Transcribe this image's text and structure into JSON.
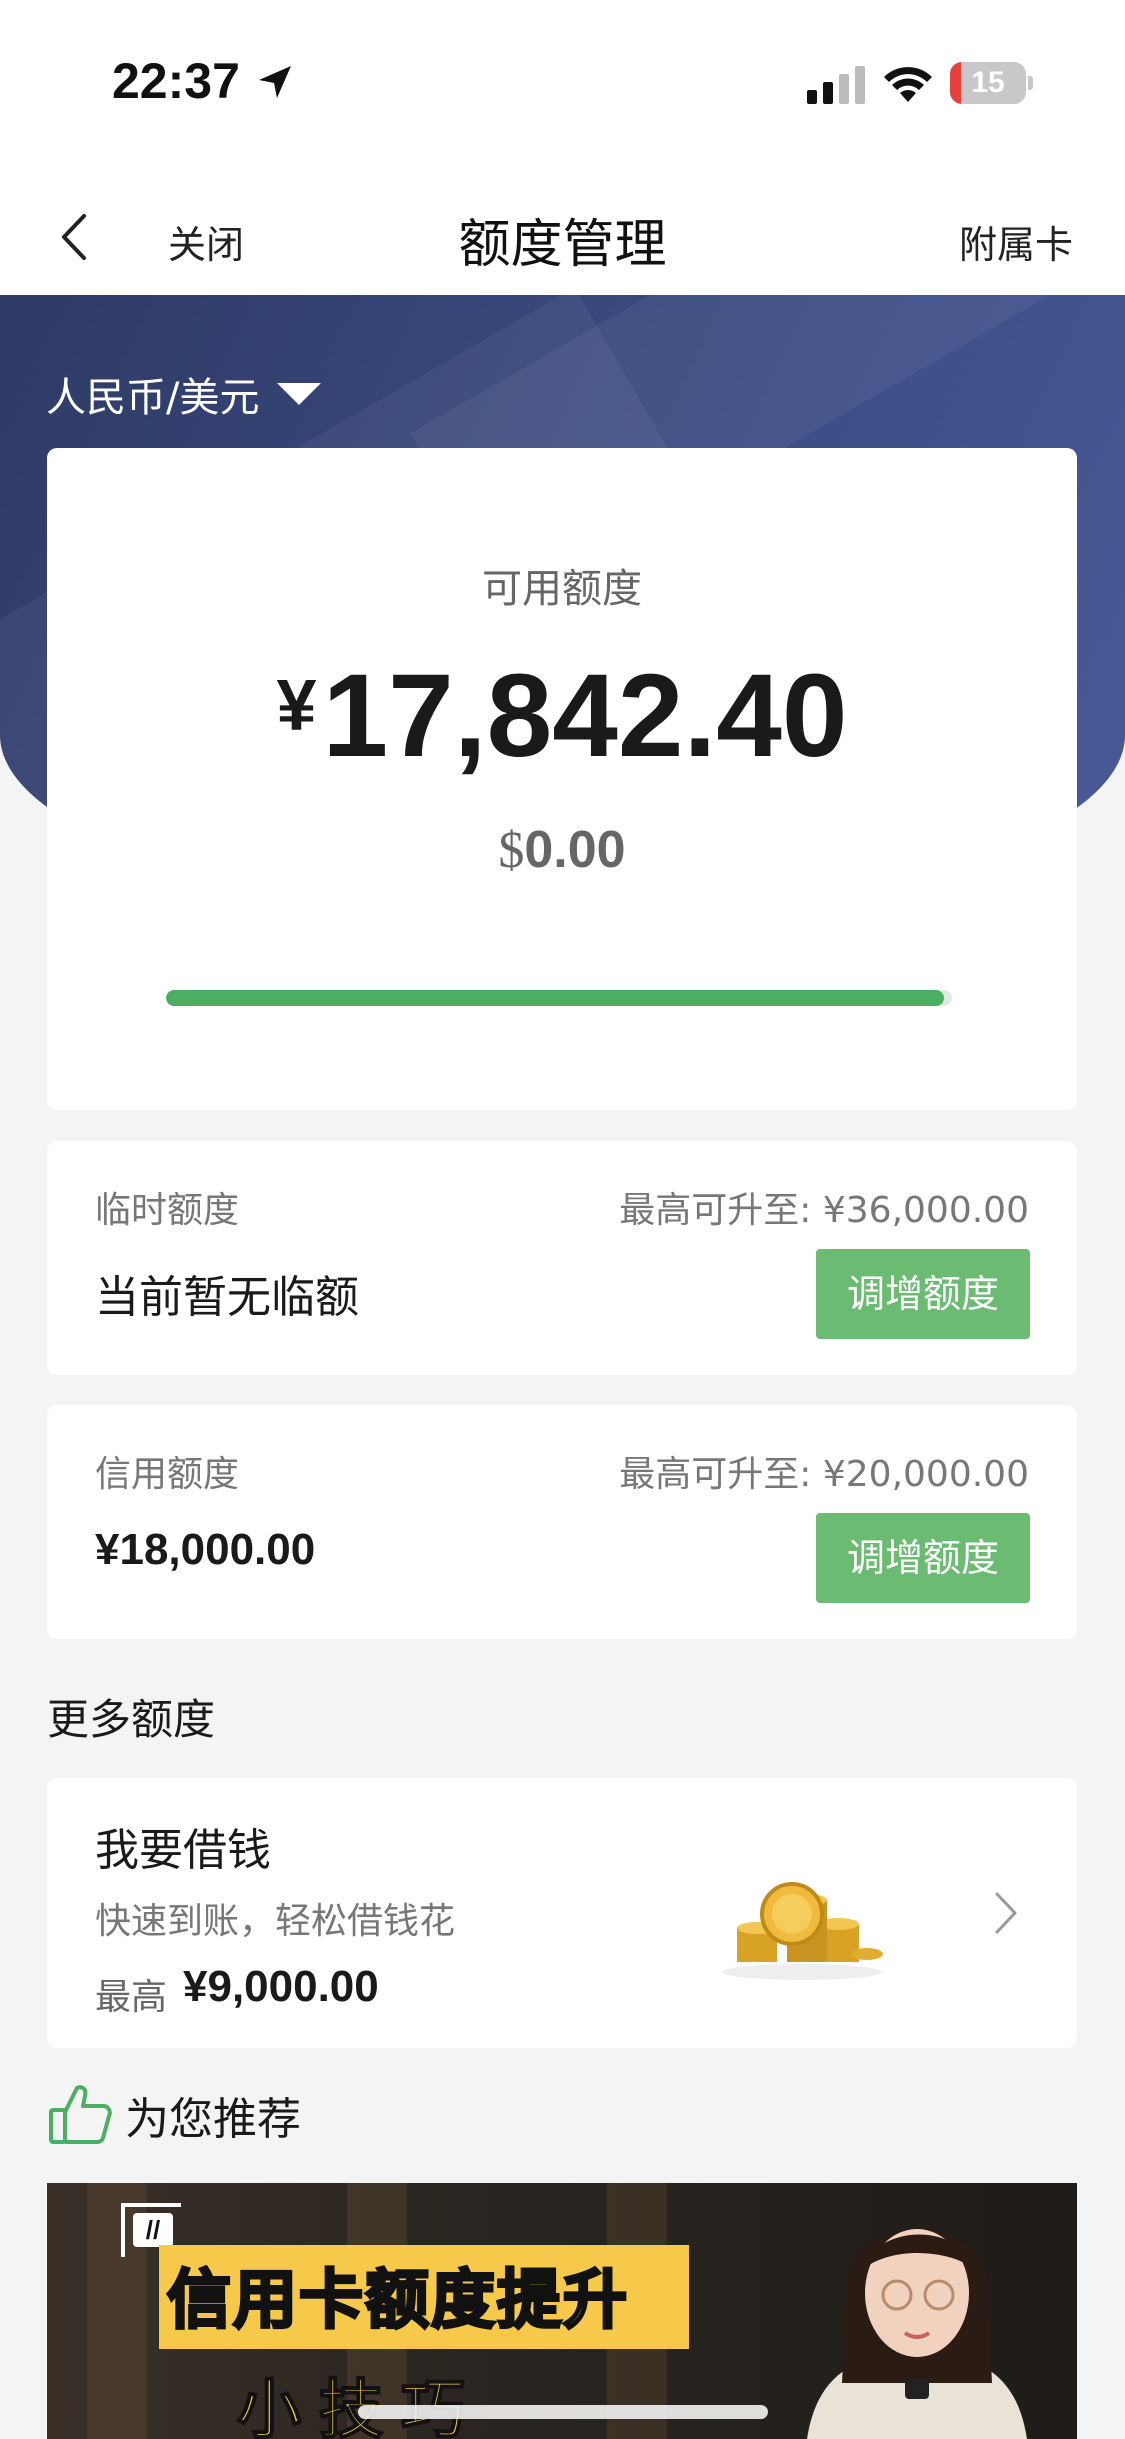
{
  "status_bar": {
    "time": "22:37",
    "battery_level": "15",
    "battery_fraction": 0.15,
    "icons": [
      "location-arrow-icon",
      "cellular-signal-icon",
      "wifi-icon",
      "battery-icon"
    ]
  },
  "nav": {
    "back_icon": "chevron-left-icon",
    "close_label": "关闭",
    "title": "额度管理",
    "right_label": "附属卡"
  },
  "currency_selector": {
    "label": "人民币/美元",
    "icon": "caret-down-icon"
  },
  "available": {
    "label": "可用额度",
    "cny_symbol": "¥",
    "cny_amount": "17,842.40",
    "usd_symbol": "$",
    "usd_amount": "0.00",
    "progress_fraction": 0.99,
    "progress_color": "#4cae62"
  },
  "temp_limit": {
    "label": "临时额度",
    "max_text": "最高可升至: ¥36,000.00",
    "value": "当前暂无临额",
    "button_label": "调增额度"
  },
  "credit_limit": {
    "label": "信用额度",
    "max_text": "最高可升至: ¥20,000.00",
    "value": "¥18,000.00",
    "button_label": "调增额度"
  },
  "more_section": {
    "title": "更多额度"
  },
  "loan": {
    "title": "我要借钱",
    "desc": "快速到账，轻松借钱花",
    "max_label": "最高",
    "max_value": "¥9,000.00",
    "icon": "gold-coins-icon"
  },
  "recommend": {
    "icon": "thumbs-up-icon",
    "title": "为您推荐",
    "banner": {
      "headline": "信用卡额度提升",
      "subline": "小技巧"
    }
  },
  "colors": {
    "header_bg": "#34427a",
    "accent_green": "#6bbb72",
    "battery_red": "#e8413c"
  }
}
